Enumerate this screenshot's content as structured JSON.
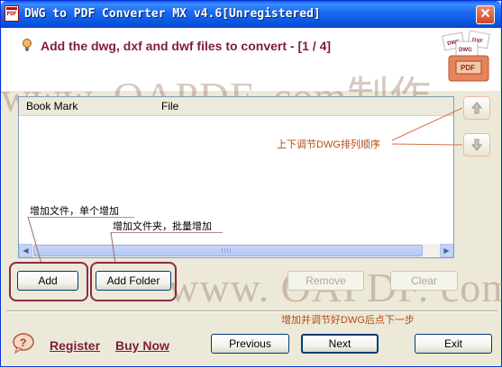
{
  "window": {
    "title": "DWG to PDF Converter MX v4.6[Unregistered]",
    "close_glyph": "✕"
  },
  "header": {
    "title": "Add the dwg, dxf and dwf files to convert - [1 / 4]",
    "logo_labels": [
      "DWF",
      "DXF",
      "DWG",
      "PDF"
    ]
  },
  "watermark": {
    "top": "www. OAPDF. com制作",
    "bottom": "www. OAPDF. com制作"
  },
  "file_list": {
    "columns": [
      "Book Mark",
      "File"
    ],
    "rows": [],
    "scroll_left": "◀",
    "scroll_right": "▶"
  },
  "buttons": {
    "add": "Add",
    "add_folder": "Add Folder",
    "remove": "Remove",
    "clear": "Clear",
    "previous": "Previous",
    "next": "Next",
    "exit": "Exit"
  },
  "links": {
    "register": "Register",
    "buy_now": "Buy Now"
  },
  "annotations": {
    "move_order": "上下调节DWG排列顺序",
    "add_file": "增加文件，单个增加",
    "add_folder": "增加文件夹，批量增加",
    "next_step": "增加并调节好DWG后点下一步"
  },
  "colors": {
    "title_bar": "#0a55e0",
    "header_text": "#7f1d3a",
    "annotation": "#b54a12",
    "highlight_ring": "#8c2a4a"
  },
  "icons": {
    "app": "pdf-document-icon",
    "header": "lightbulb-icon",
    "move_up": "arrow-up-icon",
    "move_down": "arrow-down-icon",
    "help": "help-icon"
  }
}
